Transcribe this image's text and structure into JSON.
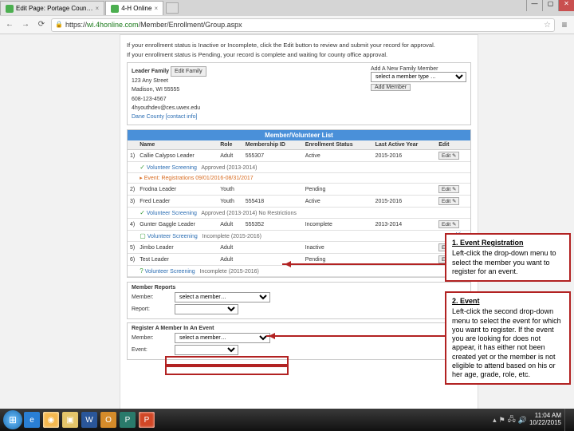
{
  "browser": {
    "tabs": [
      {
        "label": "Edit Page: Portage Coun…"
      },
      {
        "label": "4-H Online"
      }
    ],
    "window": {
      "min": "—",
      "max": "▢",
      "close": "✕"
    },
    "nav": {
      "back": "←",
      "fwd": "→",
      "reload": "⟳"
    },
    "url_prefix": "https://",
    "url_domain": "wi.4honline.com",
    "url_path": "/Member/Enrollment/Group.aspx",
    "menu": "≡"
  },
  "page": {
    "info1": "If your enrollment status is Inactive or Incomplete, click the Edit button to review and submit your record for approval.",
    "info2": "If your enrollment status is Pending, your record is complete and waiting for county office approval.",
    "family": {
      "name": "Leader Family",
      "edit": "Edit Family",
      "addr1": "123 Any Street",
      "addr2": "Madison, WI 55555",
      "phone": "608-123-4567",
      "email": "4hyouthdev@ces.uwex.edu",
      "county": "Dane County",
      "contact_link": "[contact info]",
      "add_label": "Add A New Family Member",
      "add_placeholder": "select a member type …",
      "add_btn": "Add Member"
    },
    "list": {
      "header": "Member/Volunteer List",
      "cols": [
        "",
        "Name",
        "Role",
        "Membership ID",
        "Enrollment Status",
        "Last Active Year",
        "Edit"
      ],
      "rows": [
        {
          "n": "1)",
          "name": "Callie Calypso Leader",
          "role": "Adult",
          "id": "555307",
          "status": "Active",
          "year": "2015-2016",
          "edit": "Edit ✎"
        },
        {
          "vs": true,
          "chk": "✓",
          "text": "Volunteer Screening",
          "sub": "Approved (2013-2014)"
        },
        {
          "ev": true,
          "text": "Event: Registrations 09/01/2016-08/31/2017"
        },
        {
          "n": "2)",
          "name": "Frodna Leader",
          "role": "Youth",
          "id": "",
          "status": "Pending",
          "year": "",
          "edit": "Edit ✎"
        },
        {
          "n": "3)",
          "name": "Fred Leader",
          "role": "Youth",
          "id": "555418",
          "status": "Active",
          "year": "2015-2016",
          "edit": "Edit ✎"
        },
        {
          "vs": true,
          "chk": "✓",
          "text": "Volunteer Screening",
          "sub": "Approved (2013-2014) No Restrictions"
        },
        {
          "n": "4)",
          "name": "Gunter Gaggle Leader",
          "role": "Adult",
          "id": "555352",
          "status": "Incomplete",
          "year": "2013-2014",
          "edit": "Edit ✎"
        },
        {
          "vs": true,
          "chk": "▢",
          "text": "Volunteer Screening",
          "sub": "Incomplete (2015-2016)",
          "view": "View"
        },
        {
          "n": "5)",
          "name": "Jimbo Leader",
          "role": "Adult",
          "id": "",
          "status": "Inactive",
          "year": "",
          "edit": "Edit ✎"
        },
        {
          "n": "6)",
          "name": "Test Leader",
          "role": "Adult",
          "id": "",
          "status": "Pending",
          "year": "",
          "edit": "Edit ✎"
        },
        {
          "vs": true,
          "chk": "?",
          "text": "Volunteer Screening",
          "sub": "Incomplete (2015-2016)"
        }
      ]
    },
    "reports": {
      "title": "Member Reports",
      "member_lbl": "Member:",
      "member_sel": "select a member…",
      "report_lbl": "Report:"
    },
    "register": {
      "title": "Register A Member In An Event",
      "member_lbl": "Member:",
      "member_sel": "select a member…",
      "event_lbl": "Event:"
    }
  },
  "callouts": {
    "c1": {
      "title": "1. Event Registration",
      "body": "Left-click the drop-down menu to select the member you want to register for an event."
    },
    "c2": {
      "title": "2. Event",
      "body": "Left-click the second drop-down menu to select the event for which you want to register. If the event you are looking for does not appear, it has either not been created yet or the member is not eligible to attend based on his or her age, grade, role, etc."
    }
  },
  "taskbar": {
    "time": "11:04 AM",
    "date": "10/22/2015"
  }
}
